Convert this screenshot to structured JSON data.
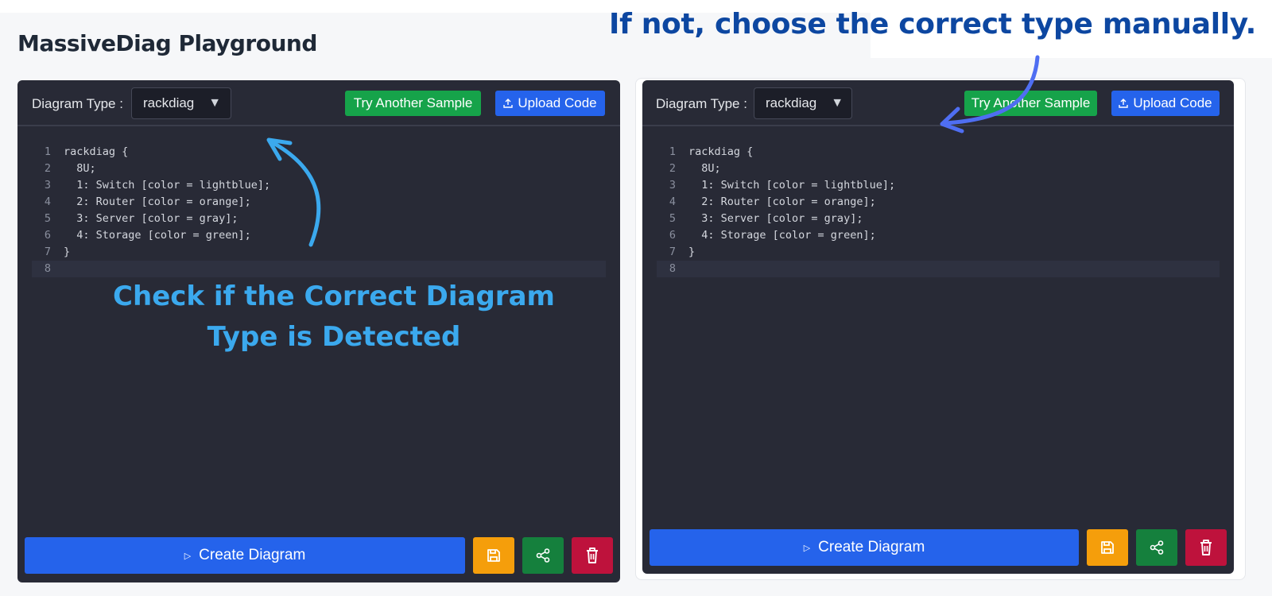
{
  "app": {
    "title": "MassiveDiag Playground"
  },
  "left_panel": {
    "diagram_type_label": "Diagram Type :",
    "diagram_type_value": "rackdiag",
    "try_sample_label": "Try Another Sample",
    "upload_label": "Upload Code",
    "code_lines": [
      {
        "n": "1",
        "text": "rackdiag {"
      },
      {
        "n": "2",
        "text": "  8U;"
      },
      {
        "n": "3",
        "text": "  1: Switch [color = lightblue];"
      },
      {
        "n": "4",
        "text": "  2: Router [color = orange];"
      },
      {
        "n": "5",
        "text": "  3: Server [color = gray];"
      },
      {
        "n": "6",
        "text": "  4: Storage [color = green];"
      },
      {
        "n": "7",
        "text": "}"
      },
      {
        "n": "8",
        "text": ""
      }
    ],
    "create_label": "Create Diagram"
  },
  "right_panel": {
    "diagram_type_label": "Diagram Type :",
    "diagram_type_value": "rackdiag",
    "try_sample_label": "Try Another Sample",
    "upload_label": "Upload Code",
    "code_lines": [
      {
        "n": "1",
        "text": "rackdiag {"
      },
      {
        "n": "2",
        "text": "  8U;"
      },
      {
        "n": "3",
        "text": "  1: Switch [color = lightblue];"
      },
      {
        "n": "4",
        "text": "  2: Router [color = orange];"
      },
      {
        "n": "5",
        "text": "  3: Server [color = gray];"
      },
      {
        "n": "6",
        "text": "  4: Storage [color = green];"
      },
      {
        "n": "7",
        "text": "}"
      },
      {
        "n": "8",
        "text": ""
      }
    ],
    "create_label": "Create Diagram"
  },
  "annotations": {
    "left_line1": "Check if the Correct Diagram",
    "left_line2": "Type is Detected",
    "top": "If not, choose the correct type manually."
  },
  "colors": {
    "editor_bg": "#282a36",
    "primary_blue": "#2563eb",
    "sample_green": "#16a34a",
    "save_yellow": "#f59e0b",
    "share_green": "#15803d",
    "delete_red": "#be123c",
    "annotation_light_blue": "#3ba9ee",
    "annotation_dark_blue": "#0d47a1"
  },
  "icons": {
    "dropdown": "triangle-down-icon",
    "upload": "upload-icon",
    "play": "play-icon",
    "save": "floppy-disk-icon",
    "share": "share-icon",
    "delete": "trash-icon"
  }
}
